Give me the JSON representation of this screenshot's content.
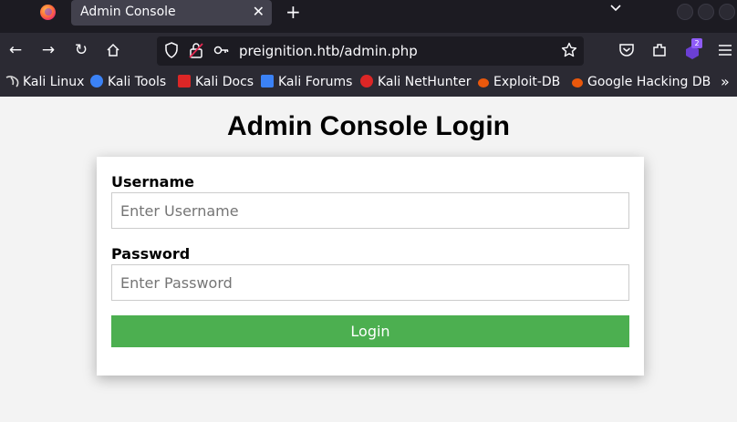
{
  "browser": {
    "tab": {
      "title": "Admin Console",
      "close": "✕"
    },
    "new_tab": "+",
    "tab_list": "⌄",
    "nav": {
      "back": "←",
      "forward": "→",
      "reload": "↻",
      "home": "⌂"
    },
    "url": "preignition.htb/admin.php",
    "extensions_badge": "2",
    "bookmarks": [
      {
        "label": "Kali Linux",
        "icon": "kali-dragon-icon",
        "color": "#d9d9d9"
      },
      {
        "label": "Kali Tools",
        "icon": "kali-tools-icon",
        "color": "#3b82f6"
      },
      {
        "label": "Kali Docs",
        "icon": "kali-docs-icon",
        "color": "#dc2626"
      },
      {
        "label": "Kali Forums",
        "icon": "kali-forums-icon",
        "color": "#3b82f6"
      },
      {
        "label": "Kali NetHunter",
        "icon": "nethunter-icon",
        "color": "#dc2626"
      },
      {
        "label": "Exploit-DB",
        "icon": "exploit-db-icon",
        "color": "#ea580c"
      },
      {
        "label": "Google Hacking DB",
        "icon": "ghdb-icon",
        "color": "#ea580c"
      }
    ],
    "bookmarks_overflow": "»"
  },
  "page": {
    "title": "Admin Console Login",
    "form": {
      "username_label": "Username",
      "username_placeholder": "Enter Username",
      "username_value": "",
      "password_label": "Password",
      "password_placeholder": "Enter Password",
      "password_value": "",
      "submit_label": "Login"
    }
  },
  "colors": {
    "chrome_dark": "#1c1b22",
    "chrome": "#2b2a33",
    "login_button": "#4caf50"
  }
}
